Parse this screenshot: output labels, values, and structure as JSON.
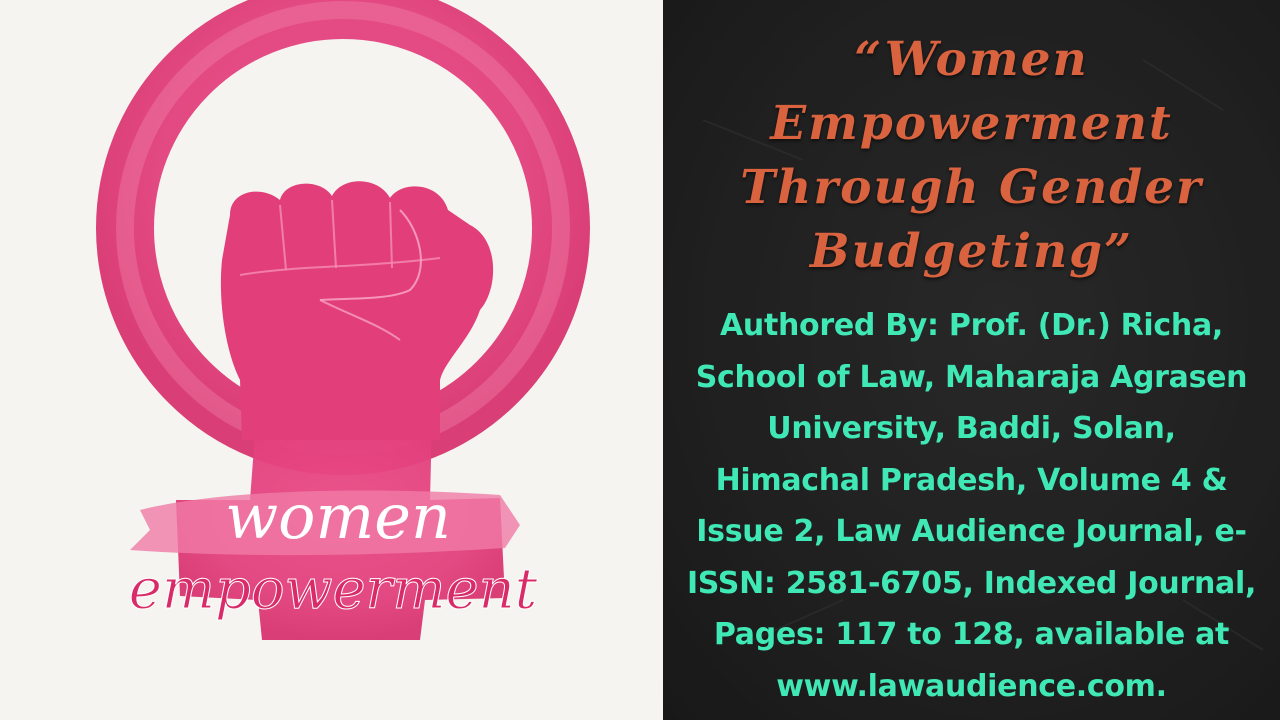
{
  "emblem": {
    "word_women": "women",
    "word_empowerment": "empowerment",
    "colors": {
      "primary": "#e73f7e",
      "light": "#f283ac",
      "dark": "#c9235f"
    }
  },
  "title_lines": [
    "“Women",
    "Empowerment",
    "Through Gender",
    "Budgeting”"
  ],
  "detail_lines": [
    "Authored By: Prof. (Dr.) Richa,",
    "School of Law, Maharaja Agrasen",
    "University, Baddi, Solan,",
    "Himachal Pradesh, Volume 4 &",
    "Issue 2, Law Audience Journal, e-",
    "ISSN: 2581-6705, Indexed Journal,",
    "Pages: 117 to 128, available at",
    "www.lawaudience.com."
  ],
  "colors": {
    "title": "#d9623f",
    "details": "#3fe8b4",
    "slate": "#222222",
    "paper": "#f5f4f0"
  }
}
